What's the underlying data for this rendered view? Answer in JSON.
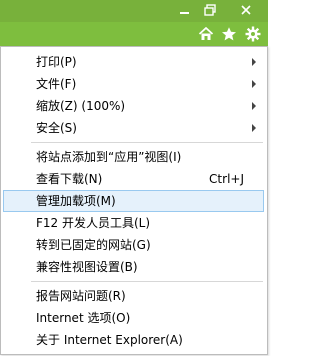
{
  "window": {
    "controls": {
      "minimize_icon": "minimize-icon",
      "maximize_icon": "restore-icon",
      "close_icon": "close-icon"
    },
    "titlebar_color": "#78b13b"
  },
  "toolbar": {
    "background": "#7ebe3e",
    "icons": [
      "home-icon",
      "favorites-star-icon",
      "tools-gear-icon"
    ]
  },
  "menu": {
    "items": [
      {
        "label": "打印(P)",
        "has_submenu": true
      },
      {
        "label": "文件(F)",
        "has_submenu": true
      },
      {
        "label": "缩放(Z) (100%)",
        "has_submenu": true
      },
      {
        "label": "安全(S)",
        "has_submenu": true
      },
      {
        "label": "将站点添加到“应用”视图(I)"
      },
      {
        "label": "查看下载(N)",
        "shortcut": "Ctrl+J"
      },
      {
        "label": "管理加载项(M)",
        "highlighted": true
      },
      {
        "label": "F12 开发人员工具(L)"
      },
      {
        "label": "转到已固定的网站(G)"
      },
      {
        "label": "兼容性视图设置(B)"
      },
      {
        "label": "报告网站问题(R)"
      },
      {
        "label": "Internet 选项(O)"
      },
      {
        "label": "关于 Internet Explorer(A)"
      }
    ]
  }
}
